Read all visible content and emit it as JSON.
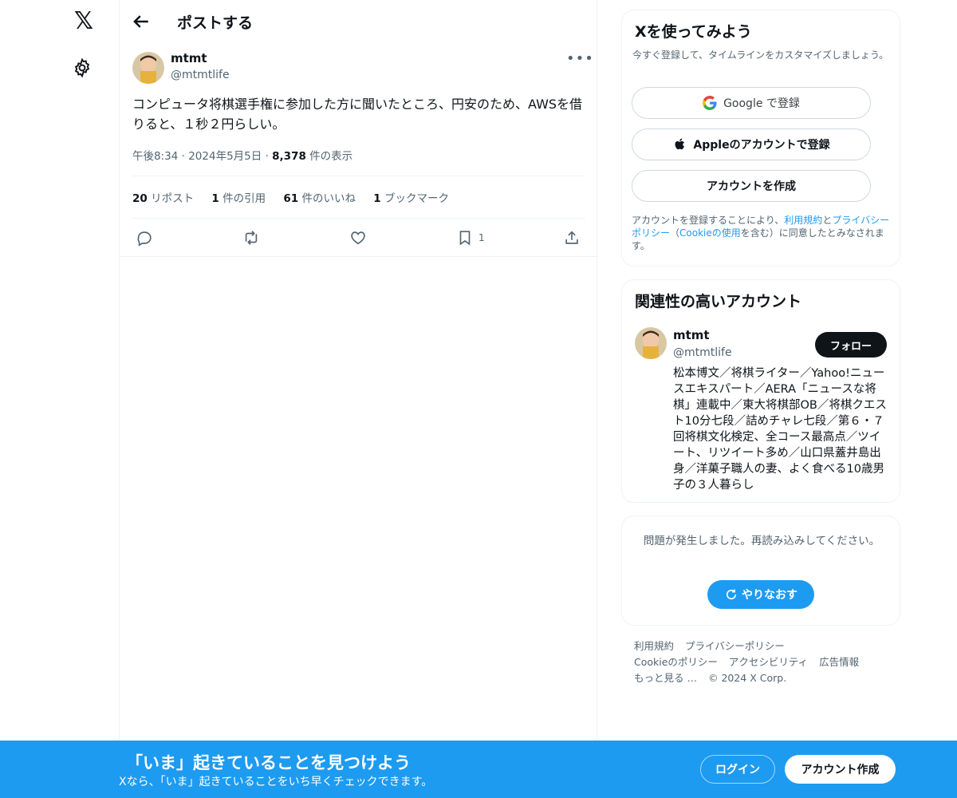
{
  "nav": {
    "logo": "𝕏",
    "logo_icon": "x-logo-icon",
    "settings_icon": "gear-icon"
  },
  "header": {
    "title": "ポストする",
    "back_icon": "arrow-left-icon"
  },
  "post": {
    "author_name": "mtmt",
    "author_handle": "@mtmtlife",
    "more_label": "•••",
    "text": "コンピュータ将棋選手権に参加した方に聞いたところ、円安のため、AWSを借りると、１秒２円らしい。",
    "time": "午後8:34",
    "date": "2024年5月5日",
    "views_count": "8,378",
    "views_label": "件の表示",
    "sep": "·",
    "stats": {
      "reposts_count": "20",
      "reposts_label": "リポスト",
      "quotes_count": "1",
      "quotes_label": "件の引用",
      "likes_count": "61",
      "likes_label": "件のいいね",
      "bookmarks_count": "1",
      "bookmarks_label": "ブックマーク"
    },
    "actions": {
      "bookmark_count": "1"
    }
  },
  "signup_card": {
    "title": "Xを使ってみよう",
    "subtitle": "今すぐ登録して、タイムラインをカスタマイズしましょう。",
    "google_label": "Google で登録",
    "apple_label": "Appleのアカウントで登録",
    "create_label": "アカウントを作成",
    "terms_prefix": "アカウントを登録することにより、",
    "terms_link": "利用規約",
    "terms_and": "と",
    "privacy_link": "プライバシーポリシー",
    "terms_mid": "（",
    "cookie_link": "Cookieの使用",
    "terms_suffix": "を含む）に同意したとみなされます。"
  },
  "related_card": {
    "title": "関連性の高いアカウント",
    "name": "mtmt",
    "handle": "@mtmtlife",
    "follow_label": "フォロー",
    "bio": "松本博文／将棋ライター／Yahoo!ニュースエキスパート／AERA「ニュースな将棋」連載中／東大将棋部OB／将棋クエスト10分七段／詰めチャレ七段／第６・７回将棋文化検定、全コース最高点／ツイート、リツイート多め／山口県蓋井島出身／洋菓子職人の妻、よく食べる10歳男子の３人暮らし"
  },
  "error_card": {
    "message": "問題が発生しました。再読み込みしてください。",
    "retry_label": "やりなおす"
  },
  "footer": {
    "terms": "利用規約",
    "privacy": "プライバシーポリシー",
    "cookie": "Cookieのポリシー",
    "accessibility": "アクセシビリティ",
    "ads": "広告情報",
    "more": "もっと見る …",
    "copyright": "© 2024 X Corp."
  },
  "banner": {
    "title": "「いま」起きていることを見つけよう",
    "subtitle": "Xなら、「いま」起きていることをいち早くチェックできます。",
    "login_label": "ログイン",
    "signup_label": "アカウント作成"
  },
  "colors": {
    "accent": "#1d9bf0",
    "text": "#0f1419",
    "muted": "#536471",
    "border": "#eff3f4"
  }
}
